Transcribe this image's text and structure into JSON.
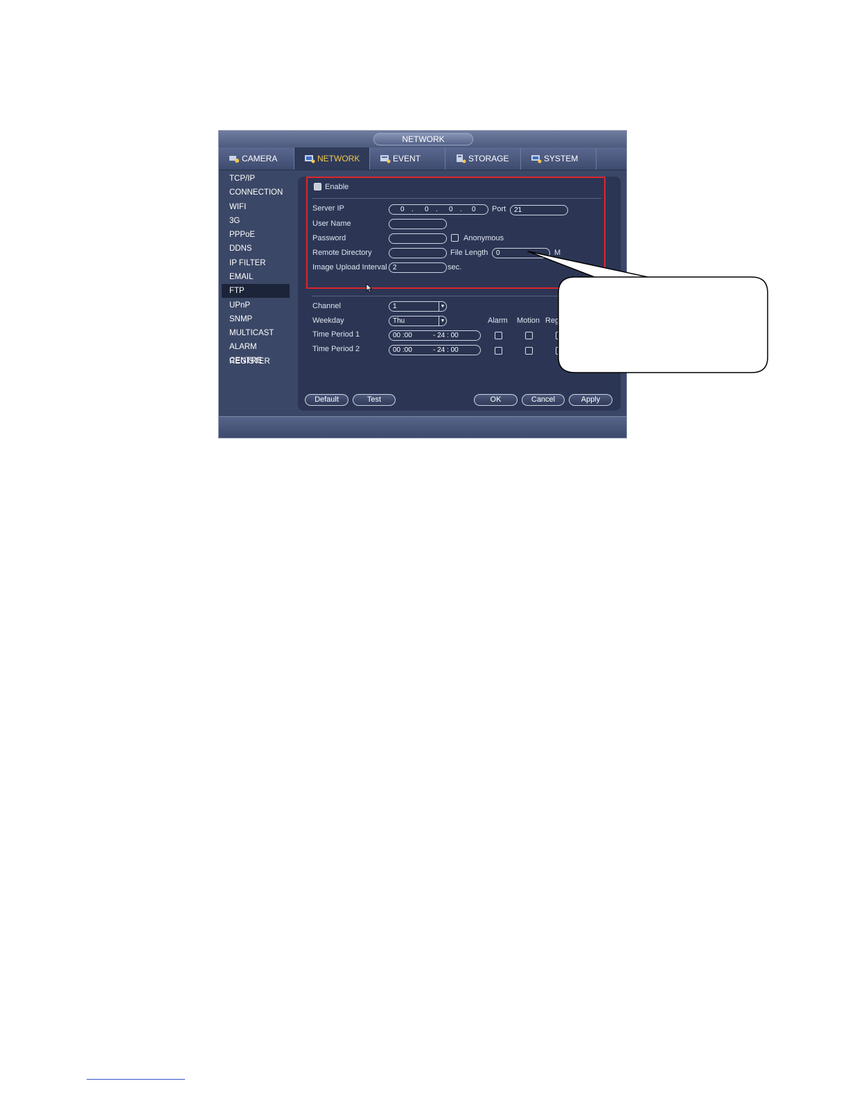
{
  "window": {
    "title": "NETWORK"
  },
  "tabs": [
    {
      "label": "CAMERA",
      "icon": "camera-icon"
    },
    {
      "label": "NETWORK",
      "icon": "network-icon"
    },
    {
      "label": "EVENT",
      "icon": "event-icon"
    },
    {
      "label": "STORAGE",
      "icon": "storage-icon"
    },
    {
      "label": "SYSTEM",
      "icon": "system-icon"
    }
  ],
  "active_tab": "NETWORK",
  "sidebar": {
    "items": [
      "TCP/IP",
      "CONNECTION",
      "WIFI",
      "3G",
      "PPPoE",
      "DDNS",
      "IP FILTER",
      "EMAIL",
      "FTP",
      "UPnP",
      "SNMP",
      "MULTICAST",
      "ALARM CENTRE",
      "REGISTER"
    ],
    "active": "FTP"
  },
  "ftp": {
    "enable_label": "Enable",
    "server_ip_label": "Server IP",
    "server_ip": [
      "0",
      "0",
      "0",
      "0"
    ],
    "port_label": "Port",
    "port_value": "21",
    "user_name_label": "User Name",
    "user_name_value": "",
    "password_label": "Password",
    "password_value": "",
    "anonymous_label": "Anonymous",
    "remote_dir_label": "Remote Directory",
    "remote_dir_value": "",
    "file_length_label": "File Length",
    "file_length_value": "0",
    "file_length_unit": "M",
    "upload_interval_label": "Image Upload Interval",
    "upload_interval_value": "2",
    "upload_interval_unit": "sec."
  },
  "schedule": {
    "channel_label": "Channel",
    "channel_value": "1",
    "weekday_label": "Weekday",
    "weekday_value": "Thu",
    "col_alarm": "Alarm",
    "col_motion": "Motion",
    "col_reg": "Reg",
    "period1_label": "Time Period 1",
    "period1_start": "00 :00",
    "period1_end": "- 24 : 00",
    "period2_label": "Time Period 2",
    "period2_start": "00 :00",
    "period2_end": "- 24 : 00"
  },
  "buttons": {
    "default": "Default",
    "test": "Test",
    "ok": "OK",
    "cancel": "Cancel",
    "apply": "Apply"
  },
  "colors": {
    "window_bg": "#3b4766",
    "panel_bg": "#2c3654",
    "active_tab_text": "#f2c94c",
    "highlight_box": "#e0232c"
  }
}
